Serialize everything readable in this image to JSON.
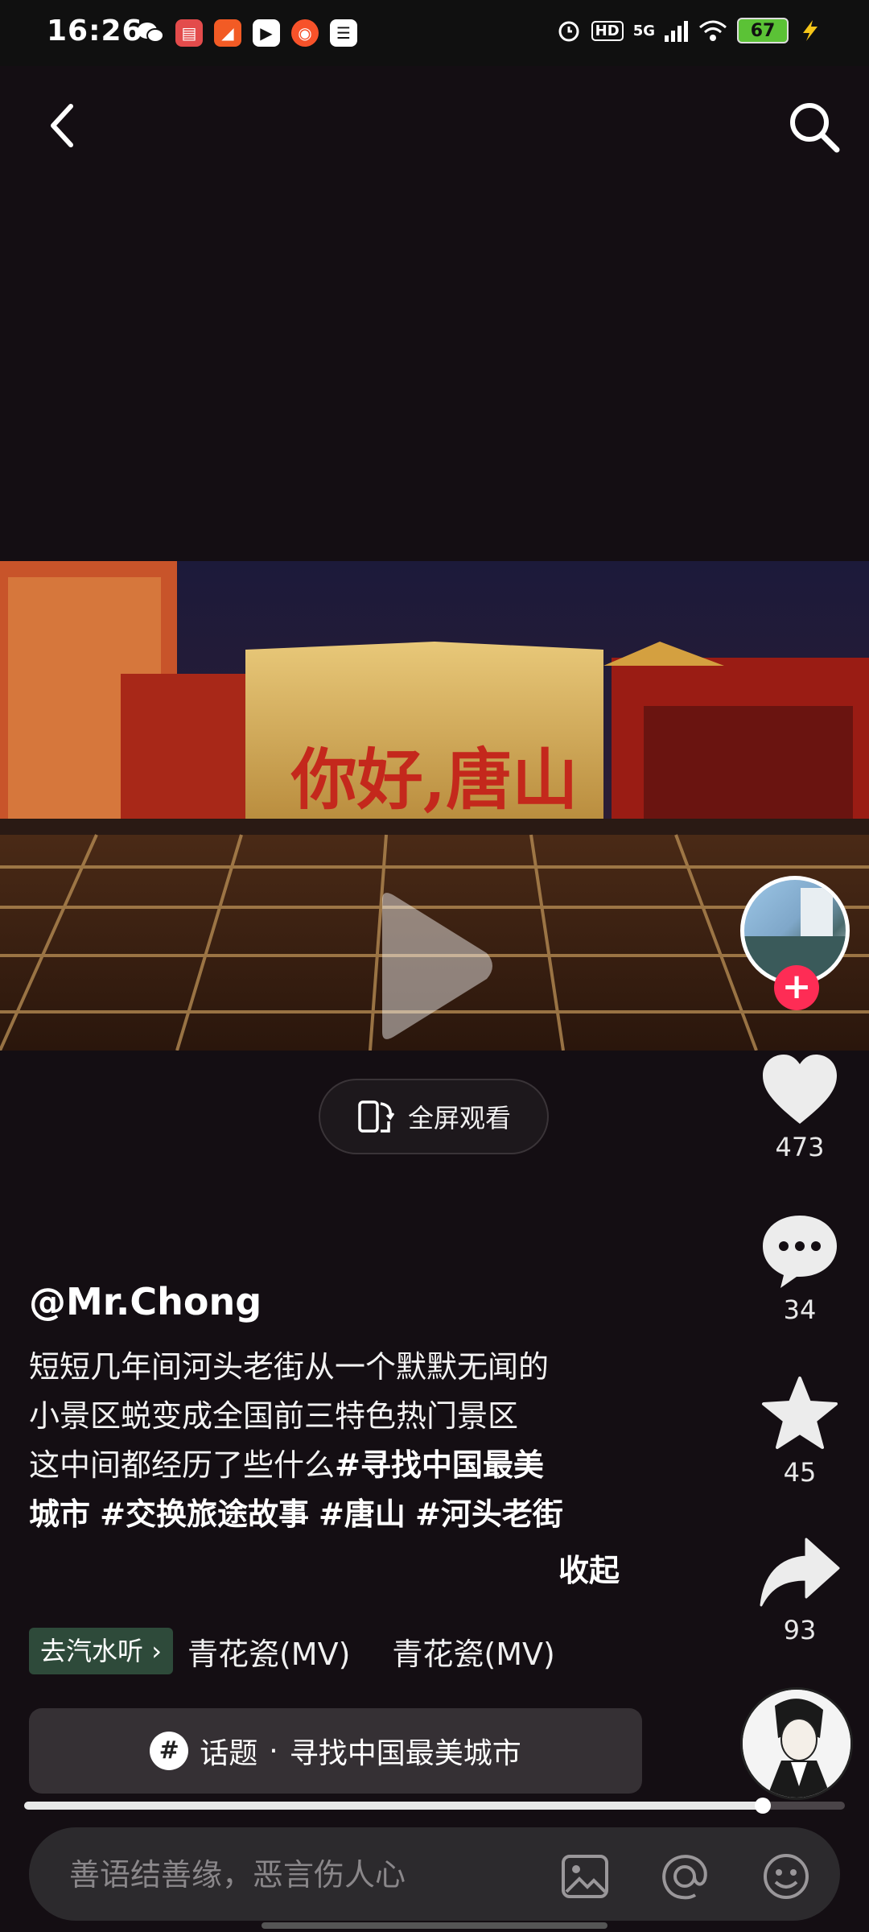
{
  "status_bar": {
    "time": "16:26",
    "network": "5G",
    "hd_label": "HD",
    "battery": "67",
    "app_icons": [
      "wechat-icon",
      "app-icon-1",
      "app-icon-2",
      "video-app-icon",
      "app-icon-3",
      "app-icon-4"
    ]
  },
  "header": {
    "back_icon": "chevron-left-icon",
    "search_icon": "search-icon"
  },
  "video": {
    "sign_text": "你好,唐山",
    "fullscreen_label": "全屏观看"
  },
  "actions": {
    "like_count": "473",
    "comment_count": "34",
    "favorite_count": "45",
    "share_count": "93"
  },
  "post": {
    "author": "@Mr.Chong",
    "description_line1": "短短几年间河头老街从一个默默无闻的",
    "description_line2": "小景区蜕变成全国前三特色热门景区",
    "description_line3": "这中间都经历了些什么",
    "hashtag1": "#寻找中国最美",
    "hashtag1_cont": "城市",
    "hashtag2": "#交换旅途故事",
    "hashtag3": "#唐山",
    "hashtag4": "#河头老街",
    "collapse_label": "收起"
  },
  "music": {
    "button_label": "去汽水听",
    "track1": "青花瓷(MV)",
    "track2": "青花瓷(MV)"
  },
  "topic": {
    "label": "话题",
    "separator": "·",
    "name": "寻找中国最美城市"
  },
  "playback": {
    "progress": 0.9
  },
  "comment": {
    "placeholder": "善语结善缘，恶言伤人心"
  },
  "colors": {
    "accent": "#fe2c55",
    "background": "#140e13"
  }
}
